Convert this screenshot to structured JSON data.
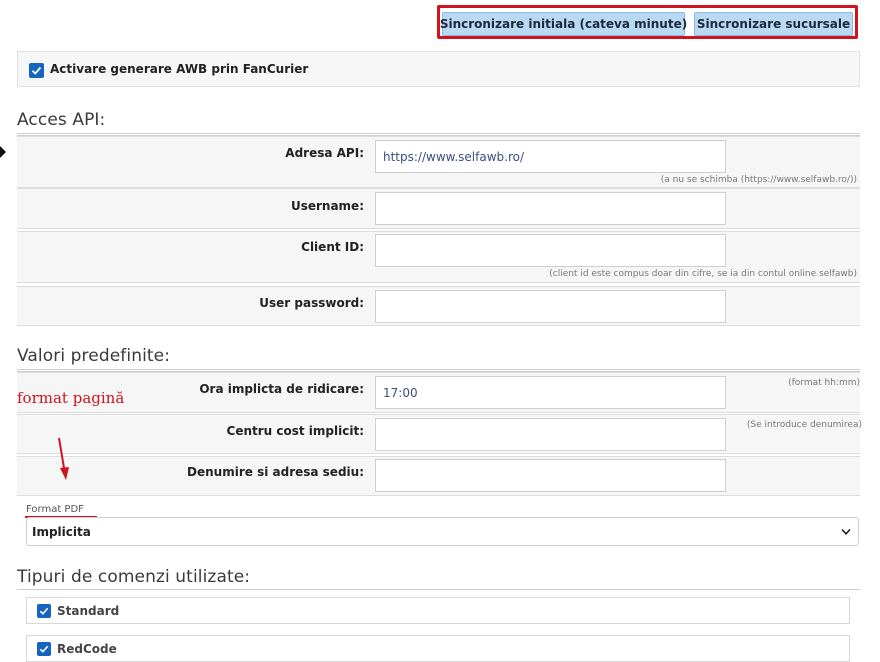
{
  "toolbar": {
    "sync_initial_label": "Sincronizare initiala (cateva minute)",
    "sync_branches_label": "Sincronizare sucursale",
    "highlight_color": "#d0141e"
  },
  "activation": {
    "label": "Activare generare AWB prin FanCurier",
    "checked": true
  },
  "api_section": {
    "title": "Acces API:",
    "fields": [
      {
        "label": "Adresa API:",
        "value": "https://www.selfawb.ro/",
        "hint": "(a nu se schimba (https://www.selfawb.ro/))"
      },
      {
        "label": "Username:",
        "value": "",
        "hint": ""
      },
      {
        "label": "Client ID:",
        "value": "",
        "hint": "(client id este compus doar din cifre, se ia din contul online selfawb)"
      },
      {
        "label": "User password:",
        "value": "",
        "hint": ""
      }
    ]
  },
  "defaults_section": {
    "title": "Valori predefinite:",
    "fields": [
      {
        "label": "Ora implicta de ridicare:",
        "value": "17:00",
        "hint": "(format hh:mm)"
      },
      {
        "label": "Centru cost implicit:",
        "value": "",
        "hint": "(Se introduce denumirea)"
      },
      {
        "label": "Denumire si adresa sediu:",
        "value": "",
        "hint": ""
      }
    ]
  },
  "annotation": {
    "text": "format pagină"
  },
  "pdf_format": {
    "label": "Format PDF",
    "selected": "Implicita"
  },
  "order_types": {
    "title": "Tipuri de comenzi utilizate:",
    "items": [
      {
        "label": "Standard",
        "checked": true
      },
      {
        "label": "RedCode",
        "checked": true
      }
    ]
  }
}
